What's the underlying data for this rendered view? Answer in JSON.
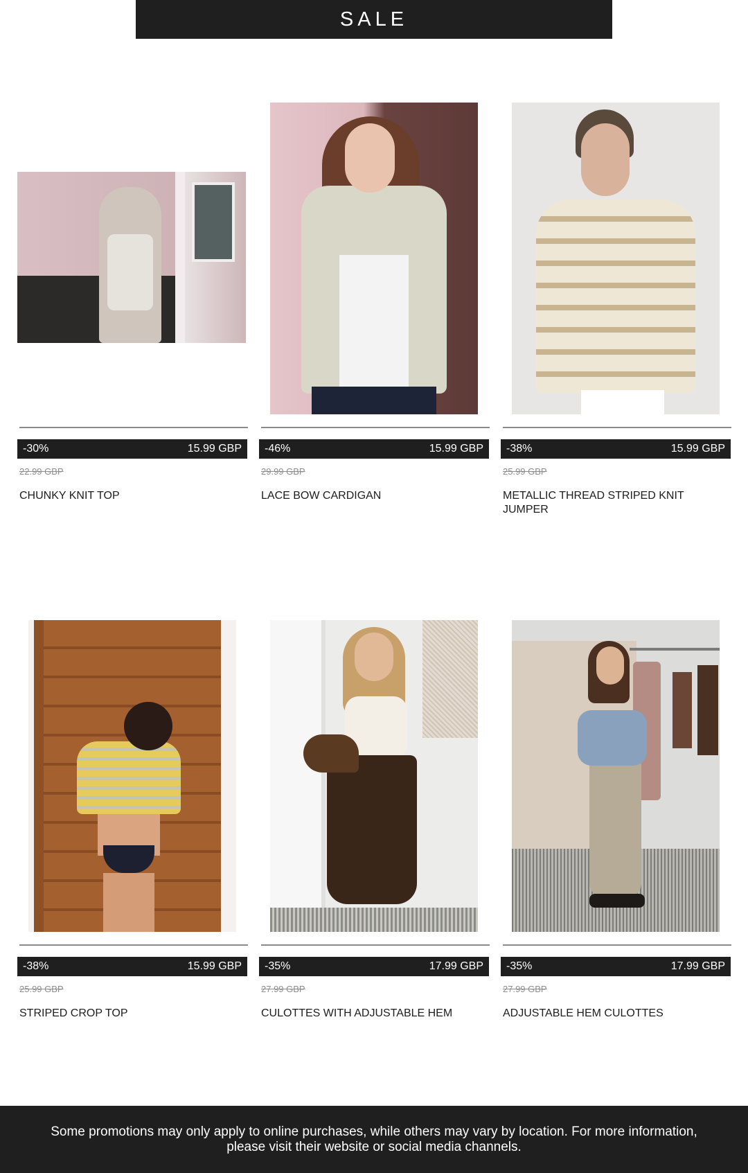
{
  "header": {
    "title": "SALE"
  },
  "products": [
    {
      "discount": "-30%",
      "price": "15.99 GBP",
      "old_price": "22.99 GBP",
      "name": "CHUNKY KNIT TOP"
    },
    {
      "discount": "-46%",
      "price": "15.99 GBP",
      "old_price": "29.99 GBP",
      "name": "LACE BOW CARDIGAN"
    },
    {
      "discount": "-38%",
      "price": "15.99 GBP",
      "old_price": "25.99 GBP",
      "name": "METALLIC THREAD STRIPED KNIT JUMPER"
    },
    {
      "discount": "-38%",
      "price": "15.99 GBP",
      "old_price": "25.99 GBP",
      "name": "STRIPED CROP TOP"
    },
    {
      "discount": "-35%",
      "price": "17.99 GBP",
      "old_price": "27.99 GBP",
      "name": "CULOTTES WITH ADJUSTABLE HEM"
    },
    {
      "discount": "-35%",
      "price": "17.99 GBP",
      "old_price": "27.99 GBP",
      "name": "ADJUSTABLE HEM CULOTTES"
    }
  ],
  "footer": {
    "text": "Some promotions may only apply to online purchases, while others may vary by location. For more information, please visit their website or social media channels."
  },
  "colors": {
    "dark": "#1f1f1f",
    "background": "#ffffff",
    "muted": "#8d8d8d"
  }
}
